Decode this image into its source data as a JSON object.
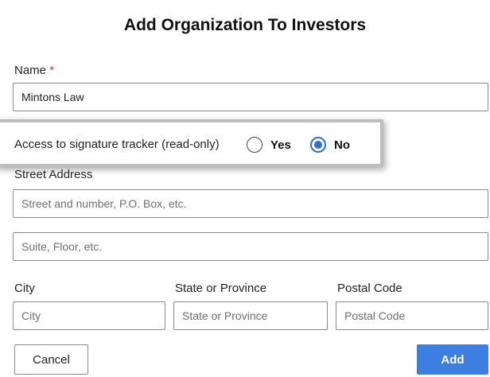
{
  "dialog": {
    "title": "Add Organization To Investors",
    "name": {
      "label": "Name",
      "required_mark": "*",
      "value": "Mintons Law"
    },
    "access": {
      "label": "Access to signature tracker (read-only)",
      "options": [
        "Yes",
        "No"
      ],
      "selected": "No"
    },
    "street": {
      "label": "Street Address",
      "line1_placeholder": "Street and number, P.O. Box, etc.",
      "line2_placeholder": "Suite, Floor, etc."
    },
    "city": {
      "label": "City",
      "placeholder": "City"
    },
    "state": {
      "label": "State or Province",
      "placeholder": "State or Province"
    },
    "postal": {
      "label": "Postal Code",
      "placeholder": "Postal Code"
    },
    "buttons": {
      "cancel": "Cancel",
      "add": "Add"
    },
    "colors": {
      "accent": "#3d7fe0",
      "required": "#d9342b"
    }
  }
}
